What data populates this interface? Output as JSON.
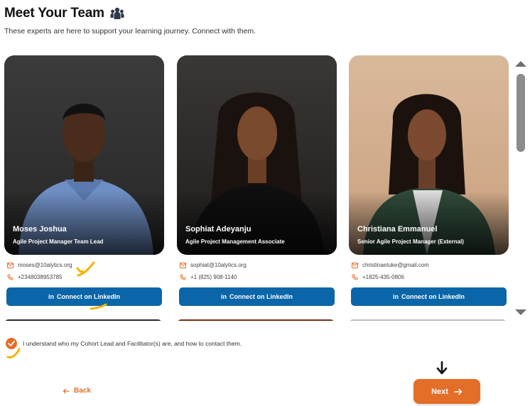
{
  "header": {
    "title": "Meet Your Team",
    "title_icon": "team-icon",
    "subtitle": "These experts are here to support your learning journey. Connect with them."
  },
  "team": [
    {
      "name": "Moses Joshua",
      "role": "Agile Project Manager Team Lead",
      "email": "moses@10alytics.org",
      "phone": "+2348038953785",
      "linkedin_label": "Connect on LinkedIn"
    },
    {
      "name": "Sophiat Adeyanju",
      "role": "Agile Project Management Associate",
      "email": "sophiat@10alytics.org",
      "phone": "+1 (825) 908-1140",
      "linkedin_label": "Connect on LinkedIn"
    },
    {
      "name": "Christiana Emmanuel",
      "role": "Senior Agile Project Manager (External)",
      "email": "christinaetuke@gmail.com",
      "phone": "+1825-435-0806",
      "linkedin_label": "Connect on LinkedIn"
    }
  ],
  "confirmation": {
    "checked": true,
    "label": "I understand who my Cohort Lead and Facilitator(s) are, and how to contact them."
  },
  "navigation": {
    "back_label": "Back",
    "next_label": "Next"
  },
  "colors": {
    "accent": "#e36e27",
    "linkedin": "#0a66a8"
  }
}
